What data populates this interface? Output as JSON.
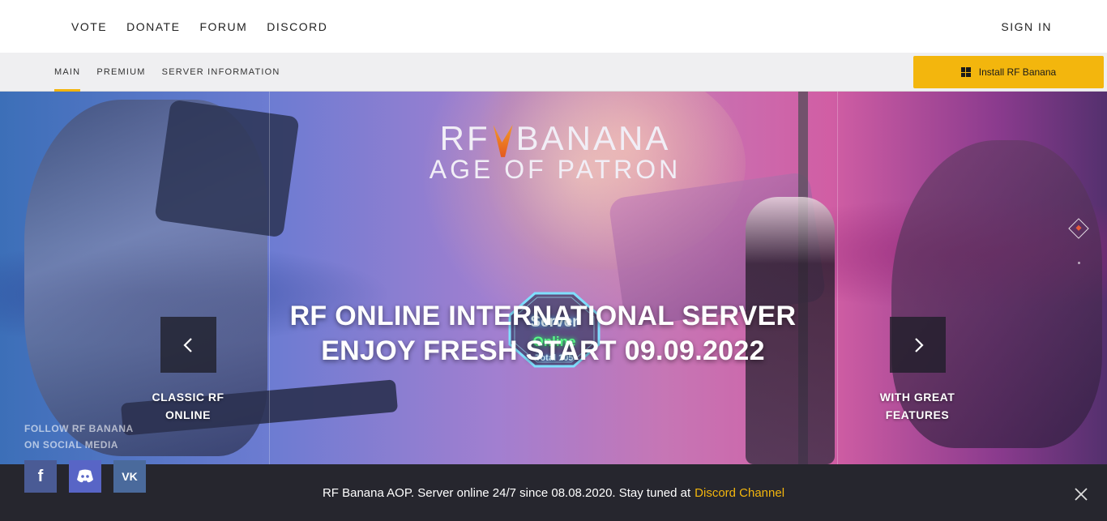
{
  "topnav": {
    "links": [
      "VOTE",
      "DONATE",
      "FORUM",
      "DISCORD"
    ],
    "signin": "SIGN IN"
  },
  "subnav": {
    "tabs": [
      "MAIN",
      "PREMIUM",
      "SERVER INFORMATION"
    ],
    "active_tab": "MAIN",
    "install_label": "Install RF Banana"
  },
  "hero": {
    "logo_line1_a": "RF",
    "logo_line1_b": "BANANA",
    "logo_line2_a": "AGE",
    "logo_line2_b": "OF PATRON",
    "badge": {
      "line1": "Server",
      "line2": "Online",
      "line3": "Total 105"
    },
    "headline_line1": "RF ONLINE INTERNATIONAL SERVER",
    "headline_line2": "ENJOY FRESH START 09.09.2022",
    "left_caption": [
      "CLASSIC RF",
      "ONLINE"
    ],
    "right_caption": [
      "WITH GREAT",
      "FEATURES"
    ],
    "follow": [
      "FOLLOW RF BANANA",
      "ON SOCIAL MEDIA"
    ],
    "socials": [
      "f",
      "VK"
    ]
  },
  "banner": {
    "message": "RF Banana AOP. Server online 24/7 since 08.08.2020. Stay tuned at",
    "link": "Discord Channel"
  },
  "colors": {
    "accent": "#f3b60d",
    "banner_bg": "#14141c"
  }
}
